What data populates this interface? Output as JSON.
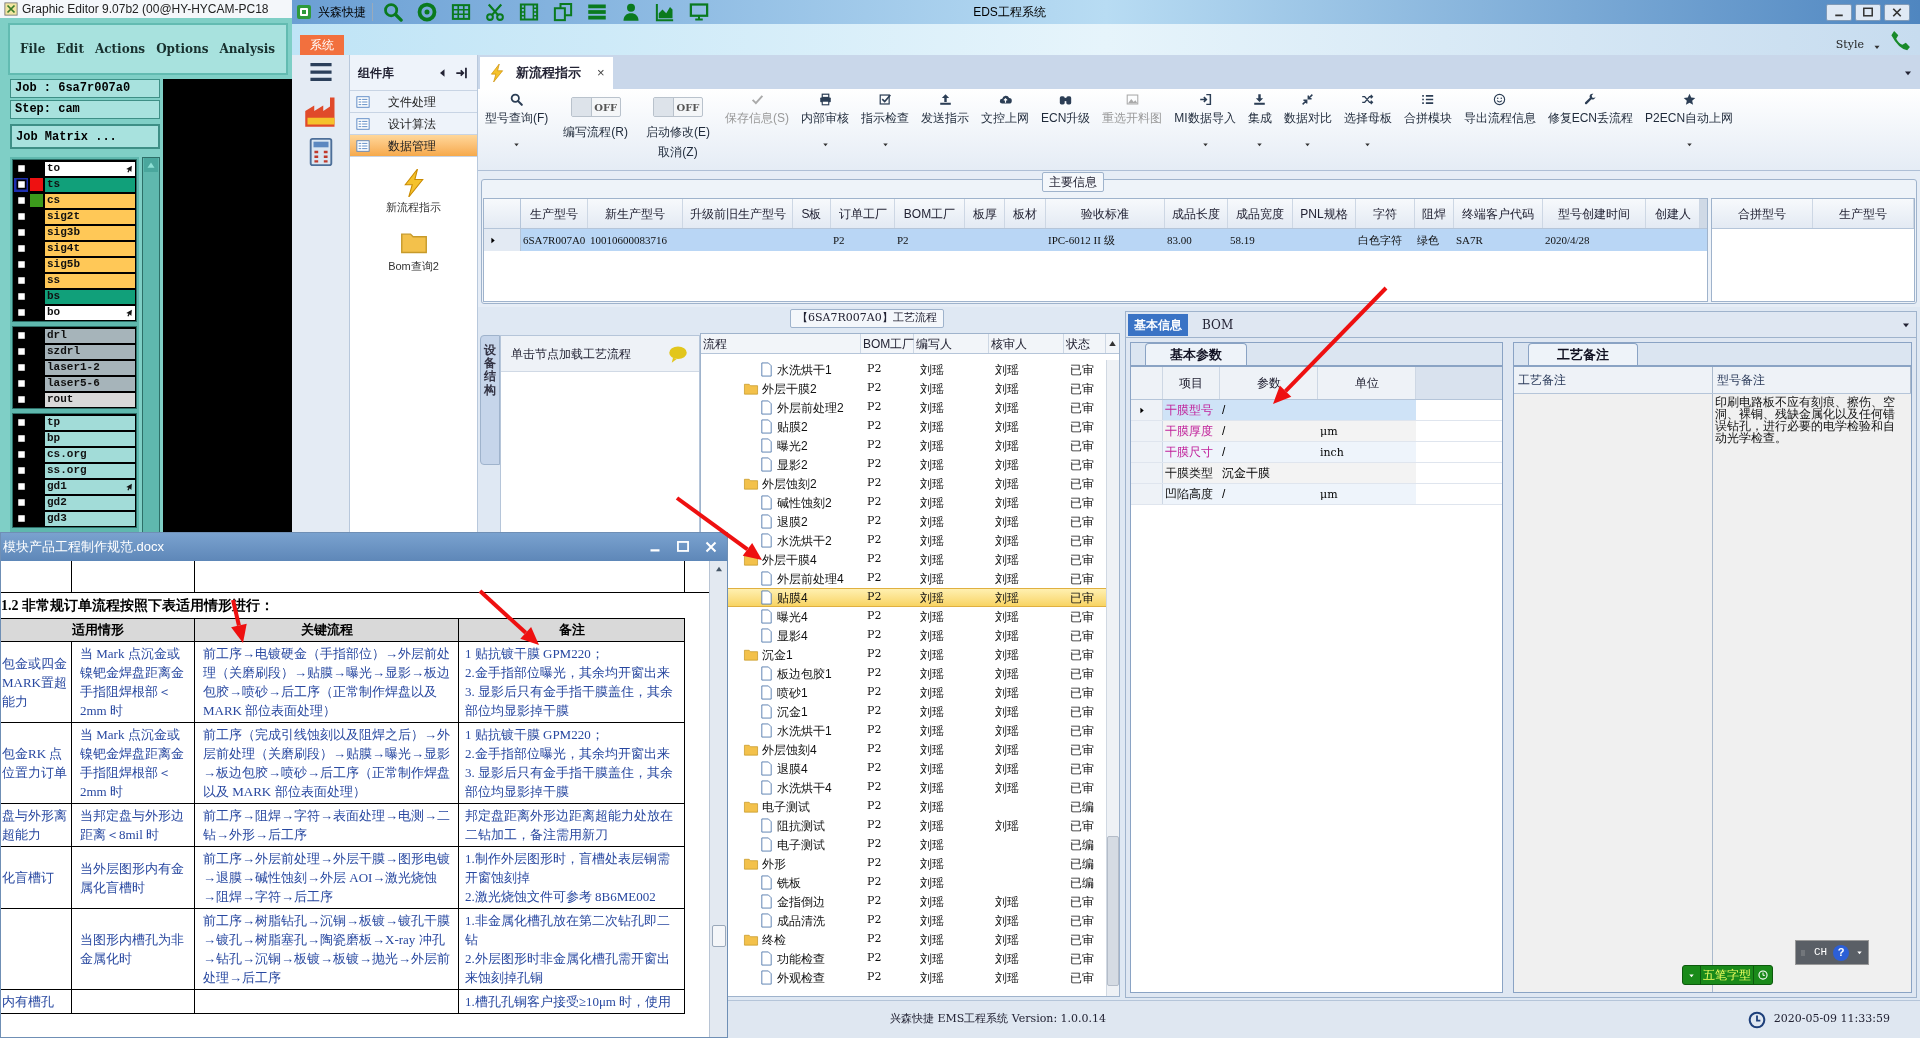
{
  "editor": {
    "title": "Graphic Editor 9.07b2 (00@HY-HYCAM-PC18",
    "menu": [
      "File",
      "Edit",
      "Actions",
      "Options",
      "Analysis"
    ],
    "job": "Job : 6sa7r007a0",
    "step": "Step: cam",
    "matrix_button": "Job Matrix ...",
    "layer_groups": [
      [
        {
          "name": "to",
          "color": "#ffffff",
          "marker": true,
          "selected": false
        },
        {
          "name": "ts",
          "color": "#11a07a",
          "swatch": {
            "color": "#ee1111"
          },
          "marker": false,
          "selected": true
        },
        {
          "name": "cs",
          "color": "#ffc857",
          "swatch": {
            "color": "#3c9a1c"
          },
          "marker": false,
          "selected": false
        },
        {
          "name": "sig2t",
          "color": "#ffc857",
          "marker": false,
          "selected": false
        },
        {
          "name": "sig3b",
          "color": "#ffc857",
          "marker": false,
          "selected": false
        },
        {
          "name": "sig4t",
          "color": "#ffc857",
          "marker": false,
          "selected": false
        },
        {
          "name": "sig5b",
          "color": "#ffc857",
          "marker": false,
          "selected": false
        },
        {
          "name": "ss",
          "color": "#ffc857",
          "marker": false,
          "selected": false
        },
        {
          "name": "bs",
          "color": "#11a07a",
          "marker": false,
          "selected": false
        },
        {
          "name": "bo",
          "color": "#ffffff",
          "marker": true,
          "selected": false
        }
      ],
      [
        {
          "name": "drl",
          "color": "#a6b4ba",
          "marker": false,
          "selected": false
        },
        {
          "name": "szdrl",
          "color": "#a6b4ba",
          "marker": false,
          "selected": false
        },
        {
          "name": "laser1-2",
          "color": "#a6b4ba",
          "marker": false,
          "selected": false
        },
        {
          "name": "laser5-6",
          "color": "#a6b4ba",
          "marker": false,
          "selected": false
        },
        {
          "name": "rout",
          "color": "#d9d9d9",
          "marker": false,
          "selected": false
        }
      ],
      [
        {
          "name": "tp",
          "color": "#a2dcd8",
          "marker": false,
          "selected": false
        },
        {
          "name": "bp",
          "color": "#a2dcd8",
          "marker": false,
          "selected": false
        },
        {
          "name": "cs.org",
          "color": "#a2dcd8",
          "marker": false,
          "selected": false
        },
        {
          "name": "ss.org",
          "color": "#a2dcd8",
          "marker": false,
          "selected": false
        },
        {
          "name": "gd1",
          "color": "#a2dcd8",
          "marker": true,
          "selected": false
        },
        {
          "name": "gd2",
          "color": "#a2dcd8",
          "marker": false,
          "selected": false
        },
        {
          "name": "gd3",
          "color": "#a2dcd8",
          "marker": false,
          "selected": false
        }
      ]
    ]
  },
  "eds": {
    "title": "EDS工程系统",
    "brand": "兴森快捷",
    "ribbon_tabs": [
      {
        "label": "系统",
        "selected": true
      }
    ],
    "style_label": "Style",
    "nav_panel": {
      "title": "组件库",
      "items": [
        {
          "label": "文件处理",
          "selected": false
        },
        {
          "label": "设计算法",
          "selected": false
        },
        {
          "label": "数据管理",
          "selected": true
        }
      ],
      "tools": [
        "新流程指示",
        "Bom查询2"
      ]
    },
    "doc_tabs": [
      {
        "label": "新流程指示",
        "close": "×",
        "selected": true
      }
    ],
    "toolbar": [
      {
        "kind": "button",
        "label": "型号查询(F)",
        "dropdown": true,
        "disabled": false
      },
      {
        "kind": "toggle",
        "label": "编写流程(R)",
        "state": "OFF",
        "on": false
      },
      {
        "kind": "toggle",
        "label": "启动修改(E)",
        "sublabel": "取消(Z)",
        "state": "OFF",
        "on": false
      },
      {
        "kind": "button",
        "label": "保存信息(S)",
        "dropdown": false,
        "disabled": true
      },
      {
        "kind": "button",
        "label": "内部审核",
        "dropdown": true,
        "disabled": false
      },
      {
        "kind": "button",
        "label": "指示检查",
        "dropdown": true,
        "disabled": false
      },
      {
        "kind": "button",
        "label": "发送指示",
        "dropdown": false,
        "disabled": false
      },
      {
        "kind": "button",
        "label": "文控上网",
        "dropdown": false,
        "disabled": false
      },
      {
        "kind": "button",
        "label": "ECN升级",
        "dropdown": false,
        "disabled": false
      },
      {
        "kind": "button",
        "label": "重选开料图",
        "dropdown": false,
        "disabled": true
      },
      {
        "kind": "button",
        "label": "MI数据导入",
        "dropdown": true,
        "disabled": false
      },
      {
        "kind": "button",
        "label": "集成",
        "dropdown": true,
        "disabled": false
      },
      {
        "kind": "button",
        "label": "数据对比",
        "dropdown": true,
        "disabled": false
      },
      {
        "kind": "button",
        "label": "选择母板",
        "dropdown": true,
        "disabled": false
      },
      {
        "kind": "button",
        "label": "合拼模块",
        "dropdown": false,
        "disabled": false
      },
      {
        "kind": "button",
        "label": "导出流程信息",
        "dropdown": false,
        "disabled": false
      },
      {
        "kind": "button",
        "label": "修复ECN丢流程",
        "dropdown": false,
        "disabled": false
      },
      {
        "kind": "button",
        "label": "P2ECN自动上网",
        "dropdown": true,
        "disabled": false
      }
    ],
    "main_info": {
      "legend": "主要信息",
      "columns": [
        "生产型号",
        "新生产型号",
        "升级前旧生产型号",
        "S板",
        "订单工厂",
        "BOM工厂",
        "板厚",
        "板材",
        "验收标准",
        "成品长度",
        "成品宽度",
        "PNL规格",
        "字符",
        "阻焊",
        "终端客户代码",
        "型号创建时间",
        "创建人"
      ],
      "rows": [
        {
          "selected": true,
          "cells": [
            "6SA7R007A0",
            "10010600083716",
            null,
            null,
            "P2",
            "P2",
            null,
            null,
            "IPC-6012 II 级",
            "83.00",
            "58.19",
            null,
            "白色字符",
            "绿色",
            "SA7R",
            "2020/4/28",
            null
          ]
        }
      ],
      "side_columns": [
        "合拼型号",
        "生产型号"
      ]
    },
    "flow_panel": {
      "side_tab": "设备结构",
      "hint": "单击节点加载工艺流程"
    },
    "flow_grid": {
      "title": "【6SA7R007A0】工艺流程",
      "columns": [
        "流程",
        "BOM工厂",
        "编写人",
        "核审人",
        "状态"
      ],
      "nodes": [
        {
          "kind": "leaf",
          "name": "水洗烘干1",
          "factory": "P2",
          "writer": "刘瑶",
          "reviewer": "刘瑶",
          "status": "已审",
          "selected": false
        },
        {
          "kind": "folder",
          "name": "外层干膜2",
          "factory": "P2",
          "writer": "刘瑶",
          "reviewer": "刘瑶",
          "status": "已审",
          "selected": false,
          "children": [
            {
              "kind": "leaf",
              "name": "外层前处理2",
              "factory": "P2",
              "writer": "刘瑶",
              "reviewer": "刘瑶",
              "status": "已审",
              "selected": false
            },
            {
              "kind": "leaf",
              "name": "贴膜2",
              "factory": "P2",
              "writer": "刘瑶",
              "reviewer": "刘瑶",
              "status": "已审",
              "selected": false
            },
            {
              "kind": "leaf",
              "name": "曝光2",
              "factory": "P2",
              "writer": "刘瑶",
              "reviewer": "刘瑶",
              "status": "已审",
              "selected": false
            },
            {
              "kind": "leaf",
              "name": "显影2",
              "factory": "P2",
              "writer": "刘瑶",
              "reviewer": "刘瑶",
              "status": "已审",
              "selected": false
            }
          ]
        },
        {
          "kind": "folder",
          "name": "外层蚀刻2",
          "factory": "P2",
          "writer": "刘瑶",
          "reviewer": "刘瑶",
          "status": "已审",
          "selected": false,
          "children": [
            {
              "kind": "leaf",
              "name": "碱性蚀刻2",
              "factory": "P2",
              "writer": "刘瑶",
              "reviewer": "刘瑶",
              "status": "已审",
              "selected": false
            },
            {
              "kind": "leaf",
              "name": "退膜2",
              "factory": "P2",
              "writer": "刘瑶",
              "reviewer": "刘瑶",
              "status": "已审",
              "selected": false
            },
            {
              "kind": "leaf",
              "name": "水洗烘干2",
              "factory": "P2",
              "writer": "刘瑶",
              "reviewer": "刘瑶",
              "status": "已审",
              "selected": false
            }
          ]
        },
        {
          "kind": "folder",
          "name": "外层干膜4",
          "factory": "P2",
          "writer": "刘瑶",
          "reviewer": "刘瑶",
          "status": "已审",
          "selected": false,
          "children": [
            {
              "kind": "leaf",
              "name": "外层前处理4",
              "factory": "P2",
              "writer": "刘瑶",
              "reviewer": "刘瑶",
              "status": "已审",
              "selected": false
            },
            {
              "kind": "leaf",
              "name": "贴膜4",
              "factory": "P2",
              "writer": "刘瑶",
              "reviewer": "刘瑶",
              "status": "已审",
              "selected": true
            },
            {
              "kind": "leaf",
              "name": "曝光4",
              "factory": "P2",
              "writer": "刘瑶",
              "reviewer": "刘瑶",
              "status": "已审",
              "selected": false
            },
            {
              "kind": "leaf",
              "name": "显影4",
              "factory": "P2",
              "writer": "刘瑶",
              "reviewer": "刘瑶",
              "status": "已审",
              "selected": false
            }
          ]
        },
        {
          "kind": "folder",
          "name": "沉金1",
          "factory": "P2",
          "writer": "刘瑶",
          "reviewer": "刘瑶",
          "status": "已审",
          "selected": false,
          "children": [
            {
              "kind": "leaf",
              "name": "板边包胶1",
              "factory": "P2",
              "writer": "刘瑶",
              "reviewer": "刘瑶",
              "status": "已审",
              "selected": false
            },
            {
              "kind": "leaf",
              "name": "喷砂1",
              "factory": "P2",
              "writer": "刘瑶",
              "reviewer": "刘瑶",
              "status": "已审",
              "selected": false
            },
            {
              "kind": "leaf",
              "name": "沉金1",
              "factory": "P2",
              "writer": "刘瑶",
              "reviewer": "刘瑶",
              "status": "已审",
              "selected": false
            },
            {
              "kind": "leaf",
              "name": "水洗烘干1",
              "factory": "P2",
              "writer": "刘瑶",
              "reviewer": "刘瑶",
              "status": "已审",
              "selected": false
            }
          ]
        },
        {
          "kind": "folder",
          "name": "外层蚀刻4",
          "factory": "P2",
          "writer": "刘瑶",
          "reviewer": "刘瑶",
          "status": "已审",
          "selected": false,
          "children": [
            {
              "kind": "leaf",
              "name": "退膜4",
              "factory": "P2",
              "writer": "刘瑶",
              "reviewer": "刘瑶",
              "status": "已审",
              "selected": false
            },
            {
              "kind": "leaf",
              "name": "水洗烘干4",
              "factory": "P2",
              "writer": "刘瑶",
              "reviewer": "刘瑶",
              "status": "已审",
              "selected": false
            }
          ]
        },
        {
          "kind": "folder",
          "name": "电子测试",
          "factory": "P2",
          "writer": "刘瑶",
          "status": "已编",
          "selected": false,
          "children": [
            {
              "kind": "leaf",
              "name": "阻抗测试",
              "factory": "P2",
              "writer": "刘瑶",
              "reviewer": "刘瑶",
              "status": "已审",
              "selected": false
            },
            {
              "kind": "leaf",
              "name": "电子测试",
              "factory": "P2",
              "writer": "刘瑶",
              "status": "已编",
              "selected": false
            }
          ]
        },
        {
          "kind": "folder",
          "name": "外形",
          "factory": "P2",
          "writer": "刘瑶",
          "status": "已编",
          "selected": false,
          "children": [
            {
              "kind": "leaf",
              "name": "铣板",
              "factory": "P2",
              "writer": "刘瑶",
              "status": "已编",
              "selected": false
            },
            {
              "kind": "leaf",
              "name": "金指倒边",
              "factory": "P2",
              "writer": "刘瑶",
              "reviewer": "刘瑶",
              "status": "已审",
              "selected": false
            },
            {
              "kind": "leaf",
              "name": "成品清洗",
              "factory": "P2",
              "writer": "刘瑶",
              "reviewer": "刘瑶",
              "status": "已审",
              "selected": false
            }
          ]
        },
        {
          "kind": "folder",
          "name": "终检",
          "factory": "P2",
          "writer": "刘瑶",
          "reviewer": "刘瑶",
          "status": "已审",
          "selected": false,
          "children": [
            {
              "kind": "leaf",
              "name": "功能检查",
              "factory": "P2",
              "writer": "刘瑶",
              "reviewer": "刘瑶",
              "status": "已审",
              "selected": false
            },
            {
              "kind": "leaf",
              "name": "外观检查",
              "factory": "P2",
              "writer": "刘瑶",
              "reviewer": "刘瑶",
              "status": "已审",
              "selected": false
            }
          ]
        }
      ]
    },
    "detail": {
      "tabs": [
        {
          "label": "基本信息",
          "selected": true
        },
        {
          "label": "BOM",
          "selected": false
        }
      ],
      "params": {
        "tab": "基本参数",
        "columns": [
          "项目",
          "参数",
          "单位"
        ],
        "rows": [
          {
            "item": "干膜型号",
            "value": "/",
            "required": true,
            "selected": true
          },
          {
            "item": "干膜厚度",
            "value": "/",
            "unit": "μm",
            "required": true,
            "selected": false
          },
          {
            "item": "干膜尺寸",
            "value": "/",
            "unit": "inch",
            "required": true,
            "selected": false
          },
          {
            "item": "干膜类型",
            "value": "沉金干膜",
            "required": false,
            "selected": false
          },
          {
            "item": "凹陷高度",
            "value": "/",
            "unit": "μm",
            "required": false,
            "selected": false
          }
        ]
      },
      "notes": {
        "tab": "工艺备注",
        "columns": [
          "工艺备注",
          "型号备注"
        ],
        "model_note": "印刷电路板不应有刻痕、擦伤、空洞、裸铜、残缺金属化以及任何错误钻孔，进行必要的电学检验和自动光学检查。"
      }
    },
    "status_bar": {
      "product": "兴森快捷 EMS工程系统 Version: 1.0.0.14",
      "datetime": "2020-05-09 11:33:59"
    }
  },
  "ime": {
    "mode": "五笔字型",
    "lang": "CH",
    "help": "?"
  },
  "document": {
    "title": "模块产品工程制作规范.docx",
    "heading": "1.2 非常规订单流程按照下表适用情形进行：",
    "columns": [
      "适用情形",
      "关键流程",
      "备注"
    ],
    "rows": [
      {
        "case": "包金或四金 MARK置超能力",
        "condition": "当 Mark 点沉金或镍钯金焊盘距离金手指阻焊根部＜2mm 时",
        "flow": "前工序→电镀硬金（手指部位）→外层前处理（关磨刷段）→贴膜→曝光→显影→板边包胶→喷砂→后工序（正常制作焊盘以及MARK 部位表面处理）",
        "notes": [
          "1 贴抗镀干膜 GPM220；",
          "2.金手指部位曝光，其余均开窗出来",
          "3. 显影后只有金手指干膜盖住，其余部位均显影掉干膜"
        ]
      },
      {
        "case": "包金RK 点位置力订单",
        "condition": "当 Mark 点沉金或镍钯金焊盘距离金手指阻焊根部＜2mm 时",
        "flow": "前工序（完成引线蚀刻以及阻焊之后）→外层前处理（关磨刷段）→贴膜→曝光→显影→板边包胶→喷砂→后工序（正常制作焊盘以及 MARK 部位表面处理）",
        "notes": [
          "1 贴抗镀干膜 GPM220；",
          "2.金手指部位曝光，其余均开窗出来",
          "3. 显影后只有金手指干膜盖住，其余部位均显影掉干膜"
        ]
      },
      {
        "case": "盘与外形离超能力",
        "condition": "当邦定盘与外形边距离＜8mil 时",
        "flow": "前工序→阻焊→字符→表面处理→电测→二钻→外形→后工序",
        "notes": [
          "邦定盘距离外形边距离超能力处放在二钻加工，备注需用新刀"
        ]
      },
      {
        "case": "化盲槽订",
        "condition": "当外层图形内有金属化盲槽时",
        "flow": "前工序→外层前处理→外层干膜→图形电镀→退膜→碱性蚀刻→外层 AOI→激光烧蚀→阻焊→字符→后工序",
        "notes": [
          "1.制作外层图形时，盲槽处表层铜需开窗蚀刻掉",
          "2.激光烧蚀文件可参考 8B6ME002"
        ]
      },
      {
        "condition": "当图形内槽孔为非金属化时",
        "flow": "前工序→树脂钻孔→沉铜→板镀→镀孔干膜→镀孔→树脂塞孔→陶瓷磨板→X-ray 冲孔→钻孔→沉铜→板镀→板镀→抛光→外层前处理→后工序",
        "notes": [
          "1.非金属化槽孔放在第二次钻孔即二钻",
          "2.外层图形时非金属化槽孔需开窗出来蚀刻掉孔铜"
        ]
      },
      {
        "case": "内有槽孔",
        "notes": [
          "1.槽孔孔铜客户接受≥10μm 时，使用"
        ]
      }
    ]
  }
}
